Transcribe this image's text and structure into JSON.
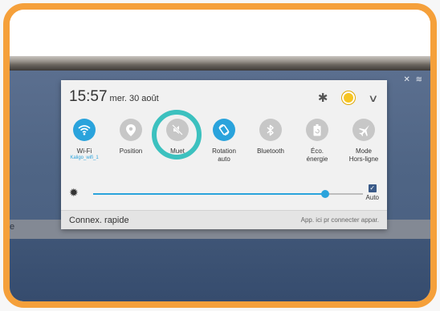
{
  "header": {
    "time": "15:57",
    "date": "mer. 30 août"
  },
  "toggles": [
    {
      "id": "wifi",
      "label": "Wi-Fi",
      "sub": "Kaligo_wifi_1",
      "state": "on",
      "icon": "wifi-icon"
    },
    {
      "id": "position",
      "label": "Position",
      "sub": "",
      "state": "off",
      "icon": "location-pin-icon"
    },
    {
      "id": "mute",
      "label": "Muet",
      "sub": "",
      "state": "off",
      "icon": "mute-icon"
    },
    {
      "id": "rotation",
      "label": "Rotation\nauto",
      "sub": "",
      "state": "on",
      "icon": "rotation-icon"
    },
    {
      "id": "bluetooth",
      "label": "Bluetooth",
      "sub": "",
      "state": "off",
      "icon": "bluetooth-icon"
    },
    {
      "id": "eco",
      "label": "Éco.\nénergie",
      "sub": "",
      "state": "off",
      "icon": "battery-saver-icon"
    },
    {
      "id": "airplane",
      "label": "Mode\nHors-ligne",
      "sub": "",
      "state": "off",
      "icon": "airplane-icon"
    }
  ],
  "brightness": {
    "level": 0.86,
    "auto_label": "Auto",
    "auto_checked": true
  },
  "footer": {
    "left": "Connex. rapide",
    "right": "App. ici pr connecter appar."
  },
  "screen": {
    "edge_text": "e"
  },
  "colors": {
    "frame": "#f5a03a",
    "accent": "#2aa3dc",
    "highlight": "#3cc1bf"
  }
}
